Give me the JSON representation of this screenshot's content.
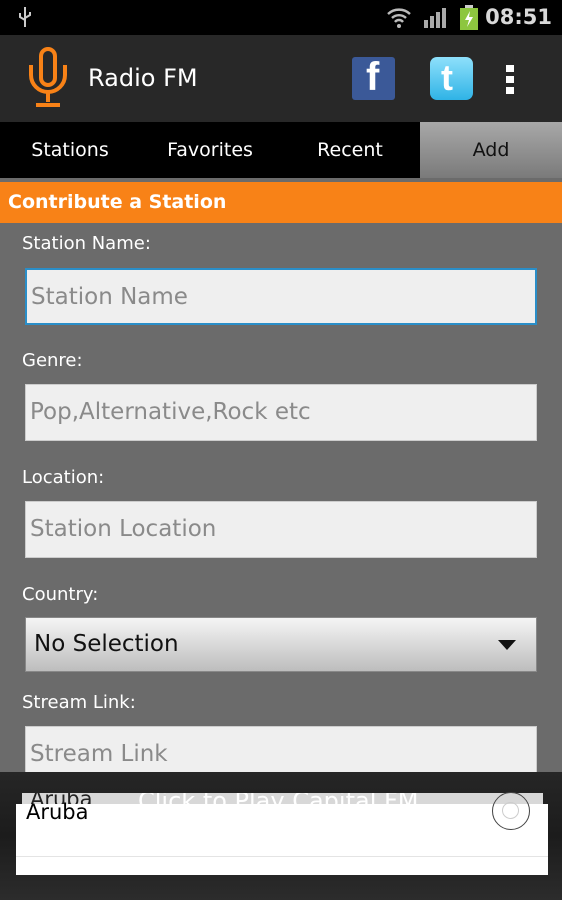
{
  "status_bar": {
    "time": "08:51",
    "icons": [
      "usb-icon",
      "wifi-icon",
      "signal-icon",
      "battery-charging-icon"
    ]
  },
  "action_bar": {
    "title": "Radio FM",
    "icons": [
      "microphone-icon",
      "facebook-icon",
      "twitter-icon",
      "overflow-menu-icon"
    ]
  },
  "tabs": [
    {
      "label": "Stations"
    },
    {
      "label": "Favorites"
    },
    {
      "label": "Recent"
    },
    {
      "label": "Add",
      "selected": true
    }
  ],
  "form": {
    "header": "Contribute a Station",
    "station_name": {
      "label": "Station Name:",
      "placeholder": "Station Name"
    },
    "genre": {
      "label": "Genre:",
      "placeholder": "Pop,Alternative,Rock etc"
    },
    "location": {
      "label": "Location:",
      "placeholder": "Station Location"
    },
    "country": {
      "label": "Country:",
      "value": "No Selection"
    },
    "stream": {
      "label": "Stream Link:",
      "placeholder": "Stream Link"
    }
  },
  "ghost": {
    "item": "Aruba",
    "text": "Click to Play Capital FM"
  },
  "dialog": {
    "items": [
      {
        "label": "Aruba",
        "selected": false
      }
    ]
  },
  "colors": {
    "accent": "#f88217",
    "focus": "#2a8ec8"
  }
}
